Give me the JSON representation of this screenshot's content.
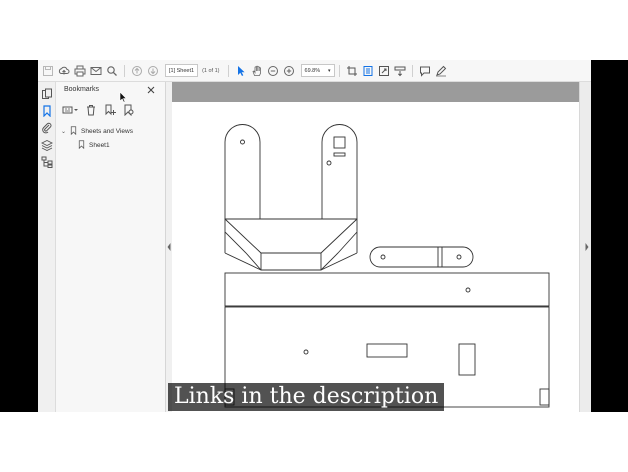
{
  "toolbar": {
    "page_field": "[1] Sheet1",
    "page_count": "(1 of 1)",
    "zoom": "69.8%"
  },
  "bookmarks": {
    "title": "Bookmarks",
    "items": [
      {
        "label": "Sheets and Views",
        "expanded": true
      },
      {
        "label": "Sheet1"
      }
    ]
  },
  "caption": "Links in the description",
  "colors": {
    "accent": "#1473e6",
    "doc_background": "#9b9b9b"
  }
}
